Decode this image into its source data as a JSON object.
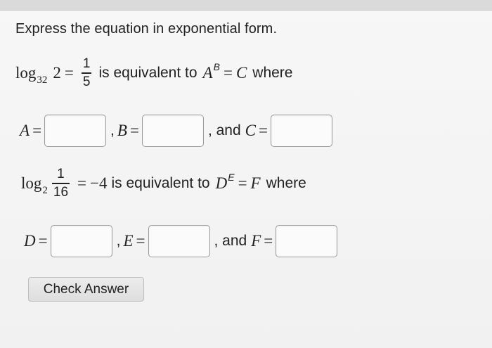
{
  "instruction": "Express the equation in exponential form.",
  "q1": {
    "log_word": "log",
    "log_base": "32",
    "argument": "2",
    "equals": "=",
    "frac_num": "1",
    "frac_den": "5",
    "middle_text": "is equivalent to",
    "lhs_base": "A",
    "lhs_exp": "B",
    "rhs": "C",
    "end_text": "where",
    "labels": {
      "a": "A",
      "b": "B",
      "c": "C"
    },
    "and_text": ", and"
  },
  "q2": {
    "log_word": "log",
    "log_base": "2",
    "frac_num": "1",
    "frac_den": "16",
    "rhs_value": "−4",
    "middle_text": "is equivalent to",
    "lhs_base": "D",
    "lhs_exp": "E",
    "rhs": "F",
    "end_text": "where",
    "labels": {
      "d": "D",
      "e": "E",
      "f": "F"
    },
    "and_text": ", and"
  },
  "eq_sign": "=",
  "comma": ",",
  "check_button": "Check Answer"
}
